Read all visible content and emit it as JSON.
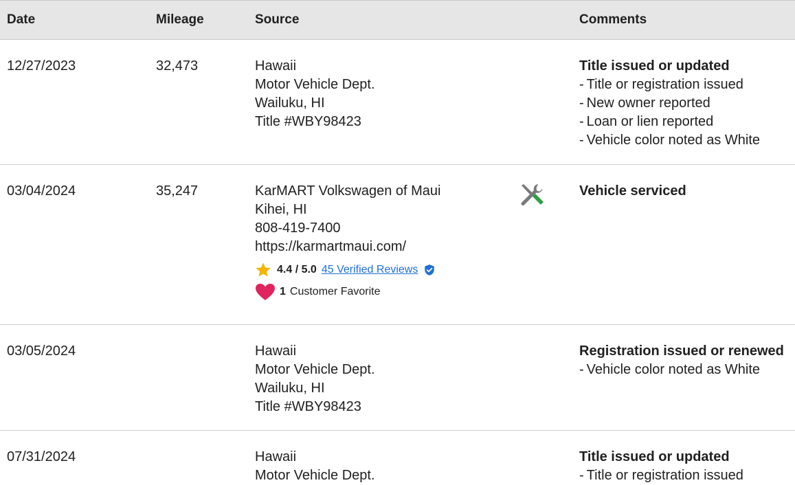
{
  "header": {
    "date": "Date",
    "mileage": "Mileage",
    "source": "Source",
    "comments": "Comments"
  },
  "rows": [
    {
      "date": "12/27/2023",
      "mileage": "32,473",
      "source": [
        "Hawaii",
        "Motor Vehicle Dept.",
        "Wailuku, HI",
        "Title #WBY98423"
      ],
      "comment_title": "Title issued or updated",
      "comment_items": [
        "Title or registration issued",
        "New owner reported",
        "Loan or lien reported",
        "Vehicle color noted as White"
      ]
    },
    {
      "date": "03/04/2024",
      "mileage": "35,247",
      "source": [
        "KarMART Volkswagen of Maui",
        "Kihei, HI",
        "808-419-7400",
        "https://karmartmaui.com/"
      ],
      "rating": {
        "score": "4.4 / 5.0",
        "reviews_link": "45 Verified Reviews"
      },
      "favorite": {
        "count": "1",
        "label": "Customer Favorite"
      },
      "icon": "service-tools-icon",
      "comment_title": "Vehicle serviced",
      "comment_items": []
    },
    {
      "date": "03/05/2024",
      "mileage": "",
      "source": [
        "Hawaii",
        "Motor Vehicle Dept.",
        "Wailuku, HI",
        "Title #WBY98423"
      ],
      "comment_title": "Registration issued or renewed",
      "comment_items": [
        "Vehicle color noted as White"
      ]
    },
    {
      "date": "07/31/2024",
      "mileage": "",
      "source": [
        "Hawaii",
        "Motor Vehicle Dept."
      ],
      "comment_title": "Title issued or updated",
      "comment_items": [
        "Title or registration issued"
      ]
    }
  ],
  "colors": {
    "header_bg": "#e6e6e6",
    "link": "#1f6fd6",
    "star": "#f5b400",
    "heart": "#e0245e",
    "wrench_green": "#2f9e44"
  }
}
